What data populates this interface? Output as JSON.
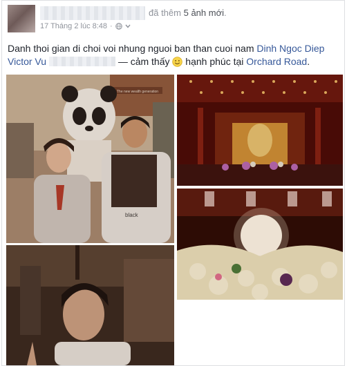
{
  "post": {
    "action_text": "đã thêm",
    "photo_count_text": "5 ảnh mới",
    "period": ".",
    "timestamp": "17 Tháng 2 lúc 8:48",
    "separator": "·",
    "text_part1": "Danh thoi gian di choi voi nhung nguoi ban than cuoi nam",
    "tag1": "Dinh Ngoc Diep",
    "tag2": "Victor Vu",
    "text_part2": "— cảm thấy",
    "feeling": "hạnh phúc",
    "location_prefix": "tại",
    "location": "Orchard Road",
    "sign_text": "The new wealth generation",
    "bag_text": "black"
  },
  "icons": {
    "privacy": "globe-icon",
    "audience_menu": "chevron-down-icon",
    "feeling": "smiley-icon"
  },
  "colors": {
    "link": "#365899",
    "meta": "#90949c",
    "text": "#1d2129"
  }
}
